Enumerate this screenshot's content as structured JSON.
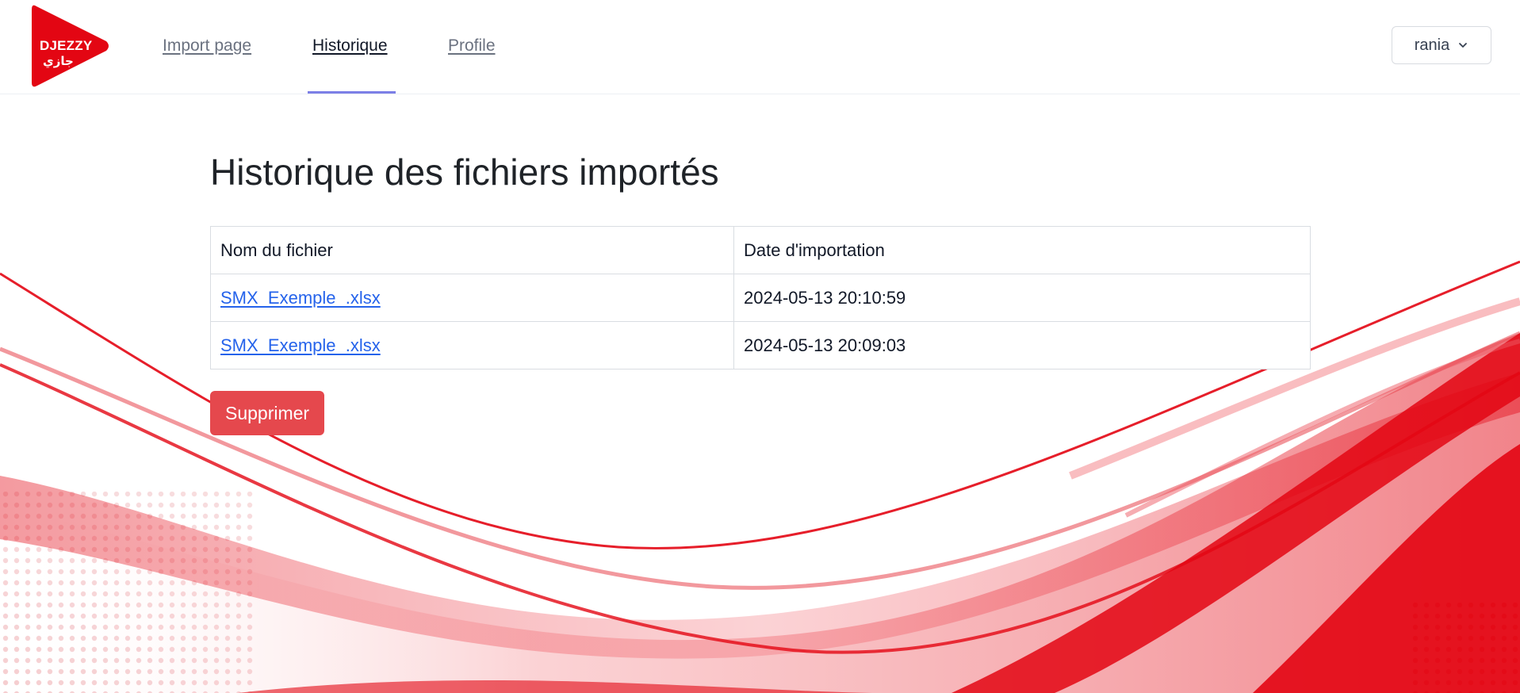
{
  "brand": {
    "logo_text": "DJEZZY",
    "logo_text_arabic": "جازي",
    "color": "#e30613"
  },
  "nav": {
    "links": [
      {
        "label": "Import page",
        "active": false
      },
      {
        "label": "Historique",
        "active": true
      },
      {
        "label": "Profile",
        "active": false
      }
    ],
    "active_indicator_color": "#7c7fe6"
  },
  "user_menu": {
    "username": "rania",
    "icon": "chevron-down-icon"
  },
  "main": {
    "title": "Historique des fichiers importés",
    "table": {
      "columns": [
        "Nom du fichier",
        "Date d'importation"
      ],
      "rows": [
        {
          "file_name": "SMX_Exemple_.xlsx",
          "date": "2024-05-13 20:10:59"
        },
        {
          "file_name": "SMX_Exemple_.xlsx",
          "date": "2024-05-13 20:09:03"
        }
      ]
    },
    "delete_button": {
      "label": "Supprimer",
      "color": "#e5484d"
    }
  },
  "colors": {
    "link": "#2563eb",
    "background_swoosh": "#e30613"
  }
}
